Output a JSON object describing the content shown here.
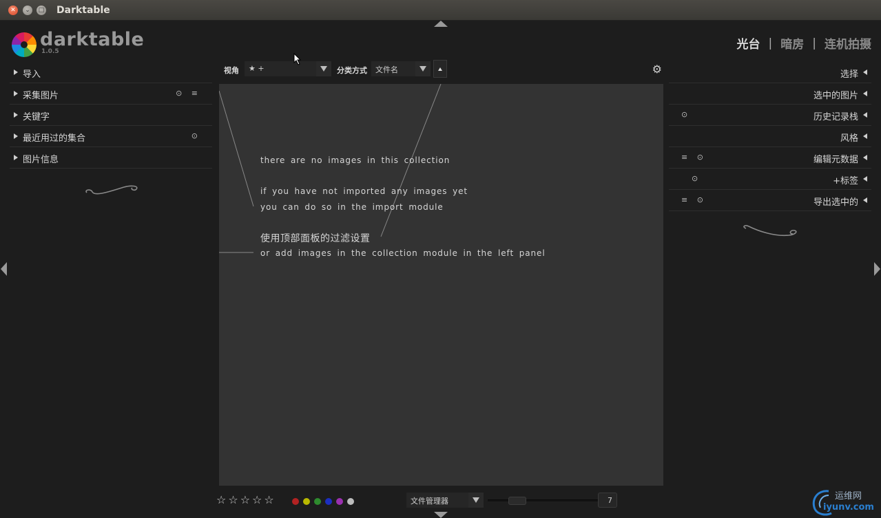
{
  "window": {
    "title": "Darktable"
  },
  "brand": {
    "name": "darktable",
    "version": "1.0.5"
  },
  "views": {
    "lighttable": "光台",
    "darkroom": "暗房",
    "tethering": "连机拍摄",
    "separator": "|"
  },
  "left_modules": [
    {
      "label": "导入",
      "icons": ""
    },
    {
      "label": "采集图片",
      "icons": "⊙ ≡"
    },
    {
      "label": "关键字",
      "icons": ""
    },
    {
      "label": "最近用过的集合",
      "icons": "⊙"
    },
    {
      "label": "图片信息",
      "icons": ""
    }
  ],
  "right_modules": [
    {
      "label": "选择",
      "icons": ""
    },
    {
      "label": "选中的图片",
      "icons": ""
    },
    {
      "label": "历史记录栈",
      "icons": "⊙"
    },
    {
      "label": "风格",
      "icons": ""
    },
    {
      "label": "编辑元数据",
      "icons": "≡ ⊙"
    },
    {
      "label": "+标签",
      "icons": "⊙"
    },
    {
      "label": "导出选中的",
      "icons": "≡ ⊙"
    }
  ],
  "filter_bar": {
    "view_label": "视角",
    "view_value": "★ +",
    "sort_label": "分类方式",
    "sort_value": "文件名"
  },
  "center_messages": [
    "there are no images in this collection",
    "if you have not imported any images yet",
    "you can do so in the import module",
    "使用顶部面板的过滤设置",
    "or add images in the collection module in the left panel"
  ],
  "bottom_bar": {
    "stars": "☆☆☆☆☆",
    "color_labels": [
      "#b22222",
      "#b8b800",
      "#2e8b2e",
      "#1c2fc0",
      "#9b30b0",
      "#bdbdbd"
    ],
    "layout_value": "文件管理器",
    "zoom_value": "7"
  },
  "watermark": {
    "line1": "运维网",
    "line2": "iyunv.com"
  }
}
